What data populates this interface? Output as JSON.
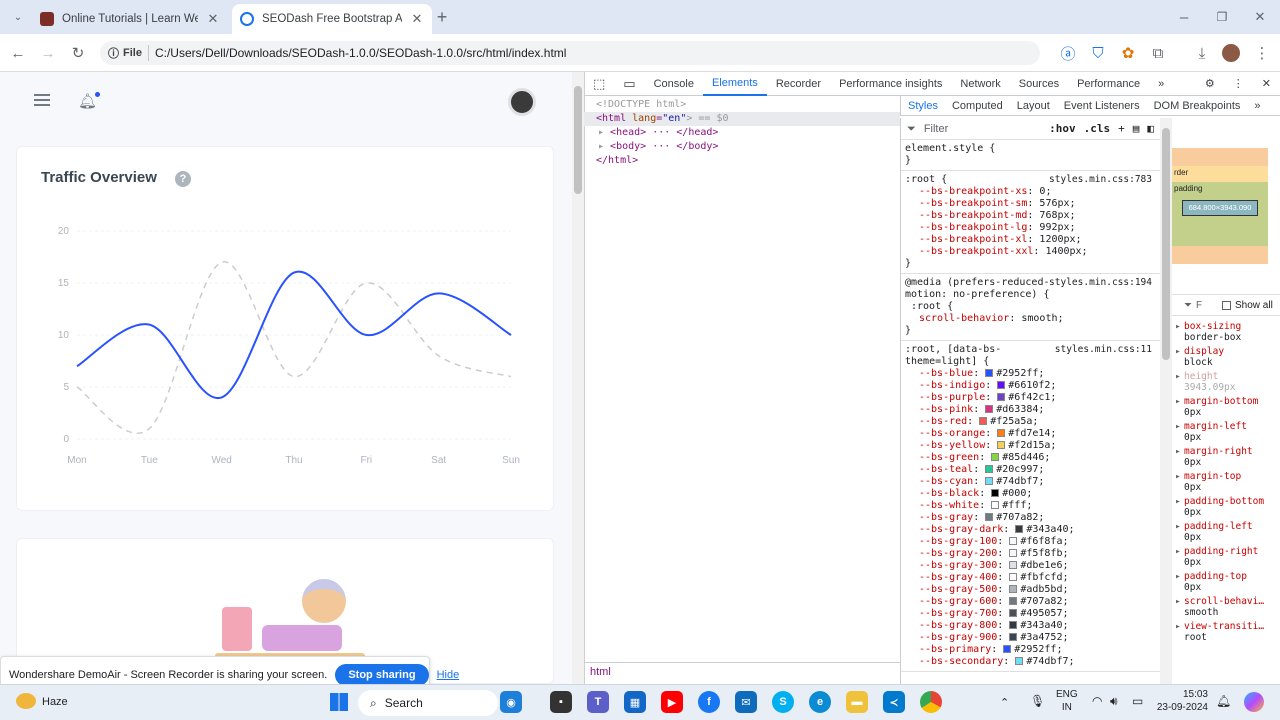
{
  "browser": {
    "tabs": [
      {
        "title": "Online Tutorials | Learn Web &",
        "active": false
      },
      {
        "title": "SEODash Free Bootstrap Admin",
        "active": true
      }
    ],
    "new_tab": "+",
    "omnibox": {
      "chip": "File",
      "url": "C:/Users/Dell/Downloads/SEODash-1.0.0/SEODash-1.0.0/src/html/index.html"
    }
  },
  "page": {
    "card_title": "Traffic Overview",
    "help": "?"
  },
  "chart_data": {
    "type": "line",
    "title": "",
    "categories": [
      "Mon",
      "Tue",
      "Wed",
      "Thu",
      "Fri",
      "Sat",
      "Sun"
    ],
    "yticks": [
      0,
      5,
      10,
      15,
      20
    ],
    "ylim": [
      0,
      20
    ],
    "series": [
      {
        "color": "#2952ff",
        "style": "solid",
        "values": [
          7,
          11,
          4,
          16,
          10,
          14,
          10
        ]
      },
      {
        "color": "#cccccc",
        "style": "dashed",
        "values": [
          5,
          1,
          17,
          6,
          15,
          8,
          6
        ]
      }
    ]
  },
  "devtools": {
    "tabs": [
      "Console",
      "Elements",
      "Recorder",
      "Performance insights",
      "Network",
      "Sources",
      "Performance"
    ],
    "active_tab": "Elements",
    "dom": {
      "doctype": "<!DOCTYPE html>",
      "html_open_tag": "<html",
      "html_attr": "lang",
      "html_attr_val": "\"en\"",
      "html_suffix": "> == $0",
      "head": "<head> ··· </head>",
      "body": "<body> ··· </body>",
      "html_close": "</html>",
      "breadcrumb": "html"
    },
    "styles_tabs": [
      "Styles",
      "Computed",
      "Layout",
      "Event Listeners",
      "DOM Breakpoints"
    ],
    "filter": {
      "placeholder": "Filter",
      "hov": ":hov",
      "cls": ".cls"
    },
    "rules": [
      {
        "selector": "element.style {",
        "source": "",
        "decls": [],
        "close": "}"
      },
      {
        "selector": ":root {",
        "source": "styles.min.css:783",
        "decls": [
          {
            "p": "--bs-breakpoint-xs",
            "v": "0;"
          },
          {
            "p": "--bs-breakpoint-sm",
            "v": "576px;"
          },
          {
            "p": "--bs-breakpoint-md",
            "v": "768px;"
          },
          {
            "p": "--bs-breakpoint-lg",
            "v": "992px;"
          },
          {
            "p": "--bs-breakpoint-xl",
            "v": "1200px;"
          },
          {
            "p": "--bs-breakpoint-xxl",
            "v": "1400px;"
          }
        ],
        "close": "}"
      },
      {
        "selector": "@media (prefers-reduced-",
        "selector2": "motion: no-preference) {",
        "source": "styles.min.css:194",
        "inner": ":root {",
        "decls": [
          {
            "p": "scroll-behavior",
            "v": "smooth;"
          }
        ],
        "close": "}"
      },
      {
        "selector": ":root, [data-bs-",
        "selector2": "theme=light] {",
        "source": "styles.min.css:11",
        "decls": [
          {
            "p": "--bs-blue",
            "v": "#2952ff;",
            "sw": "#2952ff"
          },
          {
            "p": "--bs-indigo",
            "v": "#6610f2;",
            "sw": "#6610f2"
          },
          {
            "p": "--bs-purple",
            "v": "#6f42c1;",
            "sw": "#6f42c1"
          },
          {
            "p": "--bs-pink",
            "v": "#d63384;",
            "sw": "#d63384"
          },
          {
            "p": "--bs-red",
            "v": "#f25a5a;",
            "sw": "#f25a5a"
          },
          {
            "p": "--bs-orange",
            "v": "#fd7e14;",
            "sw": "#fd7e14"
          },
          {
            "p": "--bs-yellow",
            "v": "#f2d15a;",
            "sw": "#f2d15a"
          },
          {
            "p": "--bs-green",
            "v": "#85d446;",
            "sw": "#85d446"
          },
          {
            "p": "--bs-teal",
            "v": "#20c997;",
            "sw": "#20c997"
          },
          {
            "p": "--bs-cyan",
            "v": "#74dbf7;",
            "sw": "#74dbf7"
          },
          {
            "p": "--bs-black",
            "v": "#000;",
            "sw": "#000000"
          },
          {
            "p": "--bs-white",
            "v": "#fff;",
            "sw": "#ffffff"
          },
          {
            "p": "--bs-gray",
            "v": "#707a82;",
            "sw": "#707a82"
          },
          {
            "p": "--bs-gray-dark",
            "v": "#343a40;",
            "sw": "#343a40"
          },
          {
            "p": "--bs-gray-100",
            "v": "#f6f8fa;",
            "sw": "#f6f8fa"
          },
          {
            "p": "--bs-gray-200",
            "v": "#f5f8fb;",
            "sw": "#f5f8fb"
          },
          {
            "p": "--bs-gray-300",
            "v": "#dbe1e6;",
            "sw": "#dbe1e6"
          },
          {
            "p": "--bs-gray-400",
            "v": "#fbfcfd;",
            "sw": "#fbfcfd"
          },
          {
            "p": "--bs-gray-500",
            "v": "#adb5bd;",
            "sw": "#adb5bd"
          },
          {
            "p": "--bs-gray-600",
            "v": "#707a82;",
            "sw": "#707a82"
          },
          {
            "p": "--bs-gray-700",
            "v": "#495057;",
            "sw": "#495057"
          },
          {
            "p": "--bs-gray-800",
            "v": "#343a40;",
            "sw": "#343a40"
          },
          {
            "p": "--bs-gray-900",
            "v": "#3a4752;",
            "sw": "#3a4752"
          },
          {
            "p": "--bs-primary",
            "v": "#2952ff;",
            "sw": "#2952ff"
          },
          {
            "p": "--bs-secondary",
            "v": "#74dbf7;",
            "sw": "#74dbf7"
          }
        ],
        "close": ""
      }
    ],
    "boxmodel": {
      "border": "rder",
      "padding": "padding",
      "size": "684.800×3943.090",
      "dash": "–"
    },
    "computed_filter": "F",
    "show_all": "Show all",
    "computed": [
      {
        "p": "box-sizing",
        "v": "border-box"
      },
      {
        "p": "display",
        "v": "block"
      },
      {
        "p": "height",
        "v": "3943.09px",
        "dim": true
      },
      {
        "p": "margin-bottom",
        "v": "0px"
      },
      {
        "p": "margin-left",
        "v": "0px"
      },
      {
        "p": "margin-right",
        "v": "0px"
      },
      {
        "p": "margin-top",
        "v": "0px"
      },
      {
        "p": "padding-bottom",
        "v": "0px"
      },
      {
        "p": "padding-left",
        "v": "0px"
      },
      {
        "p": "padding-right",
        "v": "0px"
      },
      {
        "p": "padding-top",
        "v": "0px"
      },
      {
        "p": "scroll-behavi…",
        "v": "smooth"
      },
      {
        "p": "view-transiti…",
        "v": "root"
      }
    ]
  },
  "share_bar": {
    "message": "Wondershare DemoAir - Screen Recorder is sharing your screen.",
    "stop": "Stop sharing",
    "hide": "Hide"
  },
  "taskbar": {
    "weather": "Haze",
    "search": "Search",
    "lang1": "ENG",
    "lang2": "IN",
    "time": "15:03",
    "date": "23-09-2024"
  }
}
